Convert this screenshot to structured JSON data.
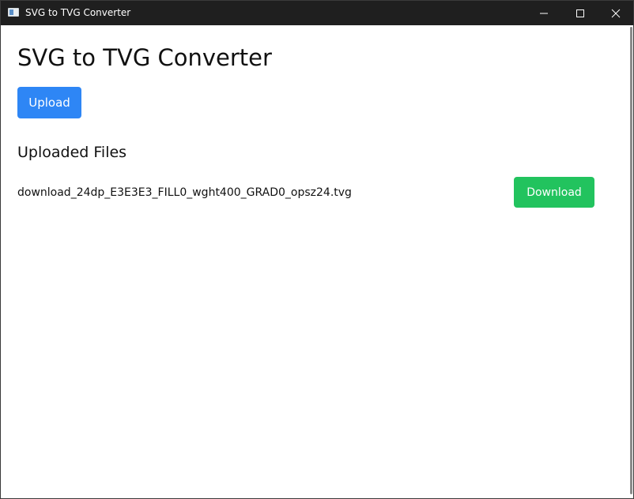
{
  "window": {
    "title": "SVG to TVG Converter",
    "icon": "app-window-icon",
    "controls": [
      "minimize-icon",
      "maximize-icon",
      "close-icon"
    ]
  },
  "page": {
    "title": "SVG to TVG Converter",
    "upload_label": "Upload",
    "section_title": "Uploaded Files"
  },
  "files": [
    {
      "name": "download_24dp_E3E3E3_FILL0_wght400_GRAD0_opsz24.tvg",
      "action_label": "Download"
    }
  ],
  "colors": {
    "titlebar": "#1f1f1f",
    "upload_button": "#2e86f5",
    "download_button": "#22c35e",
    "background": "#ffffff"
  }
}
